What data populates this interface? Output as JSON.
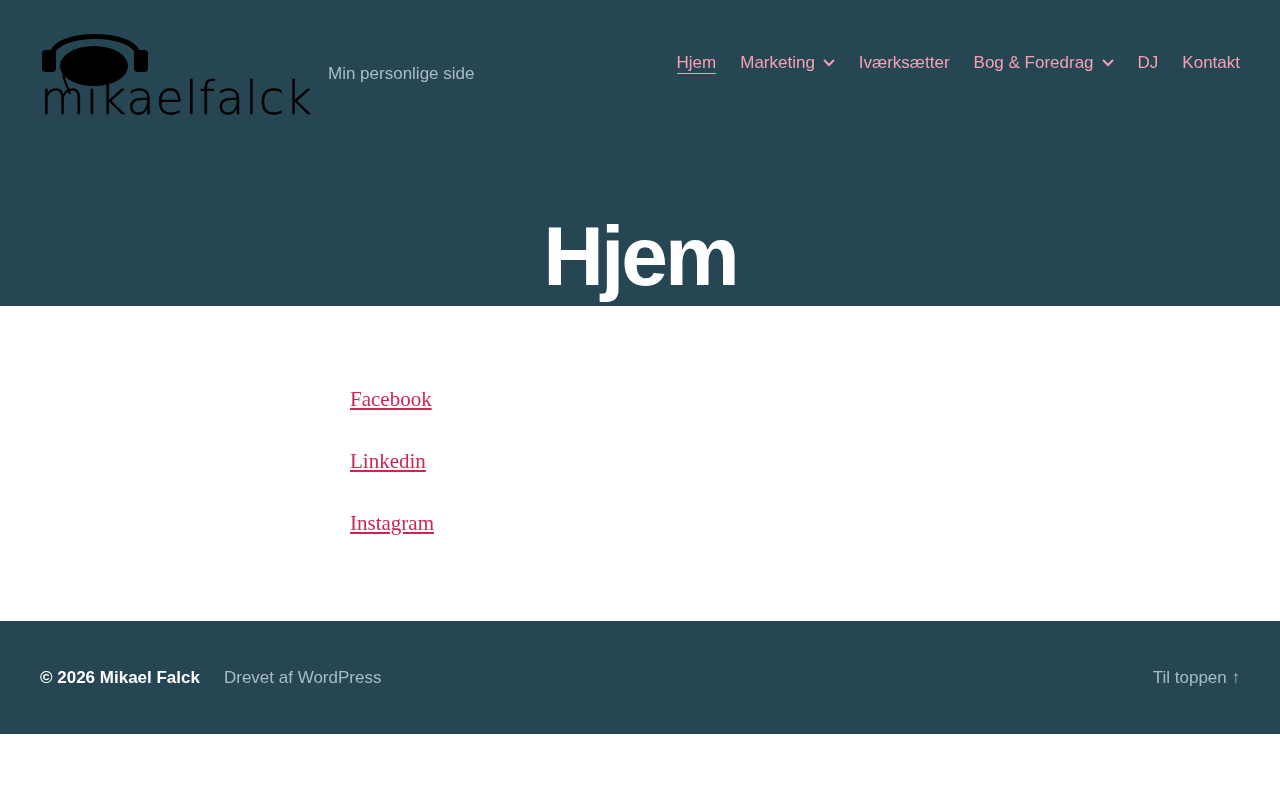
{
  "site": {
    "logo_text": "mikaelfalck",
    "tagline": "Min personlige side"
  },
  "nav": [
    {
      "label": "Hjem",
      "selected": true,
      "has_submenu": false
    },
    {
      "label": "Marketing",
      "selected": false,
      "has_submenu": true
    },
    {
      "label": "Iværksætter",
      "selected": false,
      "has_submenu": false
    },
    {
      "label": "Bog & Foredrag",
      "selected": false,
      "has_submenu": true
    },
    {
      "label": "DJ",
      "selected": false,
      "has_submenu": false
    },
    {
      "label": "Kontakt",
      "selected": false,
      "has_submenu": false
    }
  ],
  "page_title": "Hjem",
  "links": [
    "Facebook",
    "Linkedin",
    "Instagram"
  ],
  "footer": {
    "copyright": "© 2026 Mikael Falck",
    "powered_by": "Drevet af WordPress",
    "to_top": "Til toppen ↑"
  }
}
